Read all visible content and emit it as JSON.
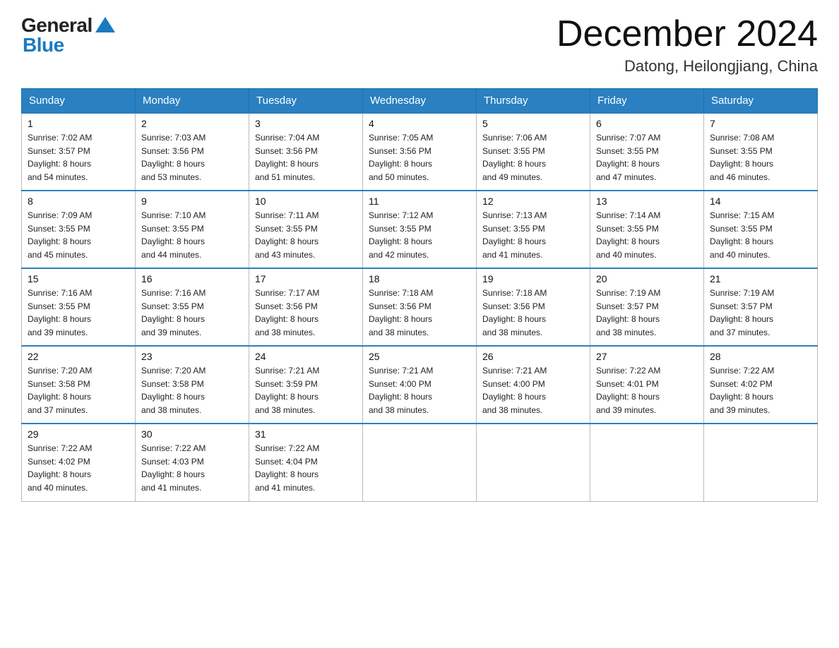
{
  "logo": {
    "general": "General",
    "blue": "Blue"
  },
  "title": "December 2024",
  "subtitle": "Datong, Heilongjiang, China",
  "days_of_week": [
    "Sunday",
    "Monday",
    "Tuesday",
    "Wednesday",
    "Thursday",
    "Friday",
    "Saturday"
  ],
  "weeks": [
    [
      {
        "day": "1",
        "sunrise": "7:02 AM",
        "sunset": "3:57 PM",
        "daylight": "8 hours and 54 minutes."
      },
      {
        "day": "2",
        "sunrise": "7:03 AM",
        "sunset": "3:56 PM",
        "daylight": "8 hours and 53 minutes."
      },
      {
        "day": "3",
        "sunrise": "7:04 AM",
        "sunset": "3:56 PM",
        "daylight": "8 hours and 51 minutes."
      },
      {
        "day": "4",
        "sunrise": "7:05 AM",
        "sunset": "3:56 PM",
        "daylight": "8 hours and 50 minutes."
      },
      {
        "day": "5",
        "sunrise": "7:06 AM",
        "sunset": "3:55 PM",
        "daylight": "8 hours and 49 minutes."
      },
      {
        "day": "6",
        "sunrise": "7:07 AM",
        "sunset": "3:55 PM",
        "daylight": "8 hours and 47 minutes."
      },
      {
        "day": "7",
        "sunrise": "7:08 AM",
        "sunset": "3:55 PM",
        "daylight": "8 hours and 46 minutes."
      }
    ],
    [
      {
        "day": "8",
        "sunrise": "7:09 AM",
        "sunset": "3:55 PM",
        "daylight": "8 hours and 45 minutes."
      },
      {
        "day": "9",
        "sunrise": "7:10 AM",
        "sunset": "3:55 PM",
        "daylight": "8 hours and 44 minutes."
      },
      {
        "day": "10",
        "sunrise": "7:11 AM",
        "sunset": "3:55 PM",
        "daylight": "8 hours and 43 minutes."
      },
      {
        "day": "11",
        "sunrise": "7:12 AM",
        "sunset": "3:55 PM",
        "daylight": "8 hours and 42 minutes."
      },
      {
        "day": "12",
        "sunrise": "7:13 AM",
        "sunset": "3:55 PM",
        "daylight": "8 hours and 41 minutes."
      },
      {
        "day": "13",
        "sunrise": "7:14 AM",
        "sunset": "3:55 PM",
        "daylight": "8 hours and 40 minutes."
      },
      {
        "day": "14",
        "sunrise": "7:15 AM",
        "sunset": "3:55 PM",
        "daylight": "8 hours and 40 minutes."
      }
    ],
    [
      {
        "day": "15",
        "sunrise": "7:16 AM",
        "sunset": "3:55 PM",
        "daylight": "8 hours and 39 minutes."
      },
      {
        "day": "16",
        "sunrise": "7:16 AM",
        "sunset": "3:55 PM",
        "daylight": "8 hours and 39 minutes."
      },
      {
        "day": "17",
        "sunrise": "7:17 AM",
        "sunset": "3:56 PM",
        "daylight": "8 hours and 38 minutes."
      },
      {
        "day": "18",
        "sunrise": "7:18 AM",
        "sunset": "3:56 PM",
        "daylight": "8 hours and 38 minutes."
      },
      {
        "day": "19",
        "sunrise": "7:18 AM",
        "sunset": "3:56 PM",
        "daylight": "8 hours and 38 minutes."
      },
      {
        "day": "20",
        "sunrise": "7:19 AM",
        "sunset": "3:57 PM",
        "daylight": "8 hours and 38 minutes."
      },
      {
        "day": "21",
        "sunrise": "7:19 AM",
        "sunset": "3:57 PM",
        "daylight": "8 hours and 37 minutes."
      }
    ],
    [
      {
        "day": "22",
        "sunrise": "7:20 AM",
        "sunset": "3:58 PM",
        "daylight": "8 hours and 37 minutes."
      },
      {
        "day": "23",
        "sunrise": "7:20 AM",
        "sunset": "3:58 PM",
        "daylight": "8 hours and 38 minutes."
      },
      {
        "day": "24",
        "sunrise": "7:21 AM",
        "sunset": "3:59 PM",
        "daylight": "8 hours and 38 minutes."
      },
      {
        "day": "25",
        "sunrise": "7:21 AM",
        "sunset": "4:00 PM",
        "daylight": "8 hours and 38 minutes."
      },
      {
        "day": "26",
        "sunrise": "7:21 AM",
        "sunset": "4:00 PM",
        "daylight": "8 hours and 38 minutes."
      },
      {
        "day": "27",
        "sunrise": "7:22 AM",
        "sunset": "4:01 PM",
        "daylight": "8 hours and 39 minutes."
      },
      {
        "day": "28",
        "sunrise": "7:22 AM",
        "sunset": "4:02 PM",
        "daylight": "8 hours and 39 minutes."
      }
    ],
    [
      {
        "day": "29",
        "sunrise": "7:22 AM",
        "sunset": "4:02 PM",
        "daylight": "8 hours and 40 minutes."
      },
      {
        "day": "30",
        "sunrise": "7:22 AM",
        "sunset": "4:03 PM",
        "daylight": "8 hours and 41 minutes."
      },
      {
        "day": "31",
        "sunrise": "7:22 AM",
        "sunset": "4:04 PM",
        "daylight": "8 hours and 41 minutes."
      },
      null,
      null,
      null,
      null
    ]
  ],
  "labels": {
    "sunrise": "Sunrise:",
    "sunset": "Sunset:",
    "daylight": "Daylight:"
  }
}
